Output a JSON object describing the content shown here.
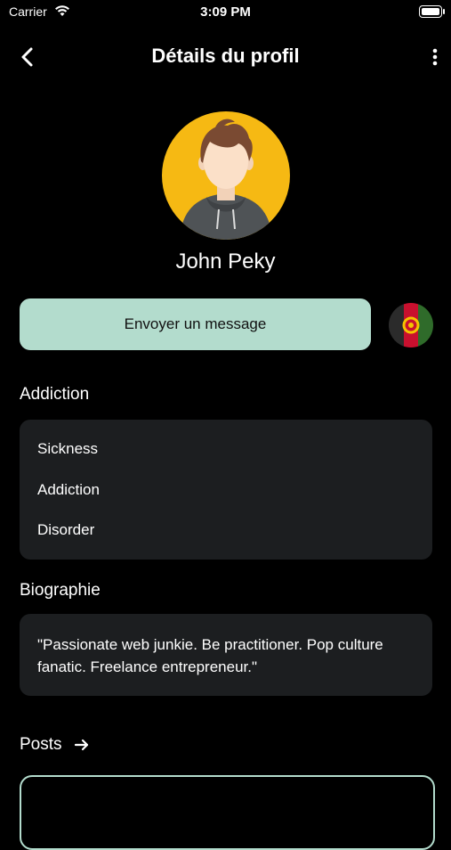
{
  "status_bar": {
    "carrier": "Carrier",
    "time": "3:09 PM"
  },
  "header": {
    "title": "Détails du profil"
  },
  "profile": {
    "name": "John Peky"
  },
  "actions": {
    "message_label": "Envoyer un message"
  },
  "addiction": {
    "title": "Addiction",
    "items": [
      "Sickness",
      "Addiction",
      "Disorder"
    ]
  },
  "biography": {
    "title": "Biographie",
    "text": "\"Passionate web junkie. Be practitioner. Pop culture fanatic. Freelance entrepreneur.\""
  },
  "posts": {
    "title": "Posts"
  },
  "colors": {
    "accent": "#b3dccd",
    "avatar_bg": "#f6b913",
    "card_bg": "#1c1e20"
  },
  "icons": {
    "back": "chevron-left-icon",
    "more": "more-vertical-icon",
    "posts_arrow": "arrow-right-icon",
    "flag": "afghanistan-flag-icon"
  }
}
